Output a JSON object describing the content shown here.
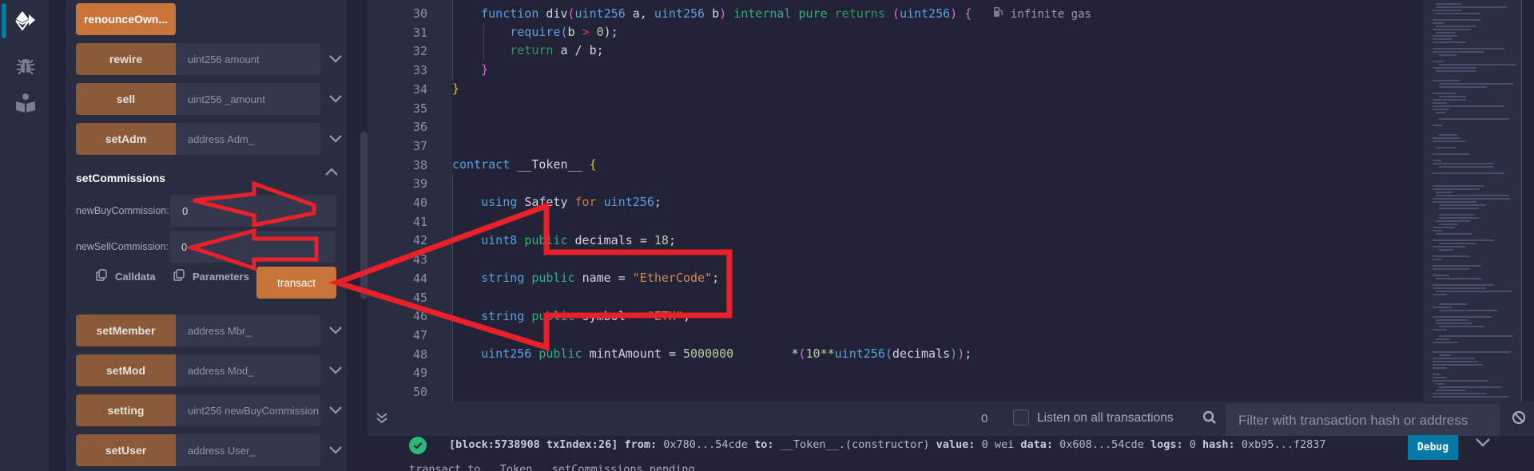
{
  "rail": {
    "items": [
      {
        "name": "deploy-run",
        "icon": "ethereum-deploy-icon",
        "active": true
      },
      {
        "name": "debugger",
        "icon": "bug-icon",
        "active": false
      },
      {
        "name": "learneth",
        "icon": "book-reader-icon",
        "active": false
      }
    ]
  },
  "panel": {
    "functions_top": [
      {
        "label": "renounceOwn...",
        "primary": true
      },
      {
        "label": "rewire",
        "placeholder": "uint256 amount"
      },
      {
        "label": "sell",
        "placeholder": "uint256 _amount"
      },
      {
        "label": "setAdm",
        "placeholder": "address Adm_"
      }
    ],
    "expanded": {
      "title": "setCommissions",
      "params": [
        {
          "label": "newBuyCommission:",
          "value": "0"
        },
        {
          "label": "newSellCommission:",
          "value": "0"
        }
      ],
      "calldata_label": "Calldata",
      "parameters_label": "Parameters",
      "transact_label": "transact"
    },
    "functions_bottom": [
      {
        "label": "setMember",
        "placeholder": "address Mbr_"
      },
      {
        "label": "setMod",
        "placeholder": "address Mod_"
      },
      {
        "label": "setting",
        "placeholder": "uint256 newBuyCommission"
      },
      {
        "label": "setUser",
        "placeholder": "address User_"
      }
    ]
  },
  "editor": {
    "line_numbers": [
      "30",
      "31",
      "32",
      "33",
      "34",
      "35",
      "36",
      "37",
      "38",
      "39",
      "40",
      "41",
      "42",
      "43",
      "44",
      "45",
      "46",
      "47",
      "48",
      "49",
      "50"
    ],
    "gas_hint": "infinite gas",
    "lines": {
      "l30": {
        "kw": "function",
        "name": "div",
        "p1": "uint256",
        "a": "a,",
        "p2": "uint256",
        "b": "b",
        "internal": "internal",
        "pure": "pure",
        "returns": "returns",
        "ret": "uint256"
      },
      "l31": {
        "kw": "require",
        "b": "b",
        "op": ">",
        "n": "0",
        "end": ");"
      },
      "l32": {
        "kw": "return",
        "rest": "a / b;"
      },
      "l38": {
        "kw": "contract",
        "name": "__Token__"
      },
      "l40": {
        "kw": "using",
        "lib": "Safety",
        "for": "for",
        "type": "uint256",
        "end": ";"
      },
      "l42": {
        "type": "uint8",
        "vis": "public",
        "name": "decimals",
        "eq": "=",
        "val": "18",
        "end": ";"
      },
      "l44": {
        "type": "string",
        "vis": "public",
        "name": "name",
        "eq": "=",
        "val": "\"EtherCode\"",
        "end": ";"
      },
      "l46": {
        "type": "string",
        "vis": "public",
        "name": "symbol",
        "eq": "=",
        "val": "\"ETH\"",
        "end": ";"
      },
      "l48": {
        "type": "uint256",
        "vis": "public",
        "name": "mintAmount",
        "eq": "=",
        "val": "5000000",
        "mul": "*",
        "ten": "10**",
        "cast": "uint256",
        "arg": "decimals",
        "end": ";"
      }
    }
  },
  "terminal": {
    "pending_count": "0",
    "listen_label": "Listen on all transactions",
    "listen_checked": false,
    "filter_placeholder": "Filter with transaction hash or address",
    "log": {
      "status": "success",
      "block": "[block:5738908 txIndex:26]",
      "from_label": "from:",
      "from": "0x780...54cde",
      "to_label": "to:",
      "to": "__Token__.(constructor)",
      "value_label": "value:",
      "value": "0 wei",
      "data_label": "data:",
      "data": "0x608...54cde",
      "logs_label": "logs:",
      "logs": "0",
      "hash_label": "hash:",
      "hash": "0xb95...f2837",
      "debug_label": "Debug"
    },
    "pending_line": "transact to __Token__.setCommissions pending ..."
  },
  "colors": {
    "accent_orange": "#c97539",
    "button_brown": "#8a5a38",
    "debug_blue": "#0779a6",
    "success_green": "#2eb67d",
    "annotation_red": "#e8202a"
  }
}
